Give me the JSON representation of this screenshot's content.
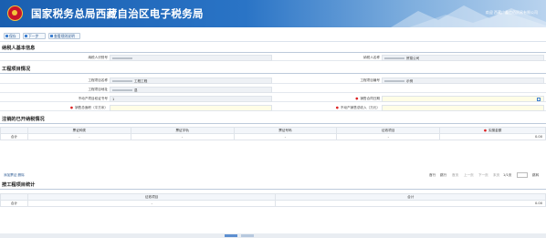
{
  "header": {
    "title": "国家税务总局西藏自治区电子税务局",
    "user": "欢迎 西藏广鑫信佰贸易有限公司"
  },
  "toolbar": {
    "save": "保存",
    "next": "下一步",
    "query": "查看规则说明"
  },
  "taxpayer_section": {
    "title": "纳税人基本信息",
    "id_label": "纳税人识别号",
    "name_label": "纳税人名称",
    "name_value": "贸易公司"
  },
  "project_section": {
    "title": "工程项目情况",
    "project_name_label": "工程项目名称",
    "project_name_value": "工程工程",
    "project_code_label": "工程项目编号",
    "project_code_value": "示例",
    "project_addr_label": "工程项目地址",
    "project_addr_value": "县",
    "cert_label": "不动产项目权证书号",
    "cert_value": "1",
    "date_label": "销售合同日期",
    "area_label": "销售总面积（平方米）",
    "income_label": "不动产销售总收入（万元）"
  },
  "issued_section": {
    "title": "注销的已开纳税情况",
    "columns": [
      "",
      "票证种类",
      "票证字轨",
      "票证号码",
      "征收项目",
      "实缴金额"
    ],
    "row": [
      "合计",
      "-",
      "-",
      "-",
      "-",
      "0.00"
    ]
  },
  "issued_actions": {
    "left": "添加票证  删除"
  },
  "pager": {
    "total": "显示",
    "first": "首页",
    "prev": "上一页",
    "next": "下一页",
    "last": "末页",
    "page": "1/1页",
    "goto": "跳转",
    "labels": [
      "首行",
      "跳行",
      "首页",
      "上一页",
      "下一页",
      "末页"
    ]
  },
  "summary_section": {
    "title": "按工程项目统计",
    "columns": [
      "",
      "征收项目",
      "合计"
    ],
    "row": [
      "合计",
      "-",
      "0.00"
    ]
  }
}
